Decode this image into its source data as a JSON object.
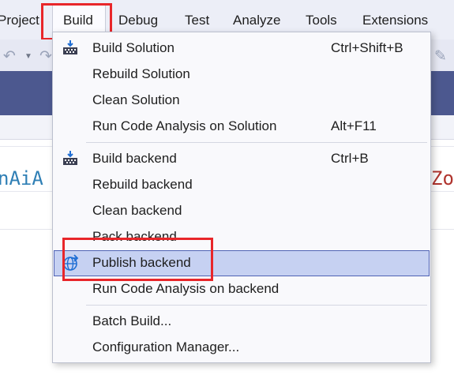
{
  "menubar": {
    "items": [
      {
        "label": "Project"
      },
      {
        "label": "Build"
      },
      {
        "label": "Debug"
      },
      {
        "label": "Test"
      },
      {
        "label": "Analyze"
      },
      {
        "label": "Tools"
      },
      {
        "label": "Extensions"
      }
    ]
  },
  "editor": {
    "code_fragment_left": "nAiA",
    "code_fragment_right": "Zo"
  },
  "build_menu": {
    "items": [
      {
        "label": "Build Solution",
        "shortcut": "Ctrl+Shift+B",
        "icon": "build-solution-icon"
      },
      {
        "label": "Rebuild Solution"
      },
      {
        "label": "Clean Solution"
      },
      {
        "label": "Run Code Analysis on Solution",
        "shortcut": "Alt+F11"
      },
      {
        "label": "Build backend",
        "shortcut": "Ctrl+B",
        "icon": "build-project-icon"
      },
      {
        "label": "Rebuild backend"
      },
      {
        "label": "Clean backend"
      },
      {
        "label": "Pack backend"
      },
      {
        "label": "Publish backend",
        "icon": "publish-globe-icon",
        "highlighted": true
      },
      {
        "label": "Run Code Analysis on backend"
      },
      {
        "label": "Batch Build..."
      },
      {
        "label": "Configuration Manager..."
      }
    ]
  },
  "colors": {
    "highlight_bg": "#c6d1f2",
    "highlight_border": "#4f62b4",
    "callout_red": "#e8262a",
    "tab_strip": "#4c588f",
    "icon_blue": "#1f6ed4"
  }
}
